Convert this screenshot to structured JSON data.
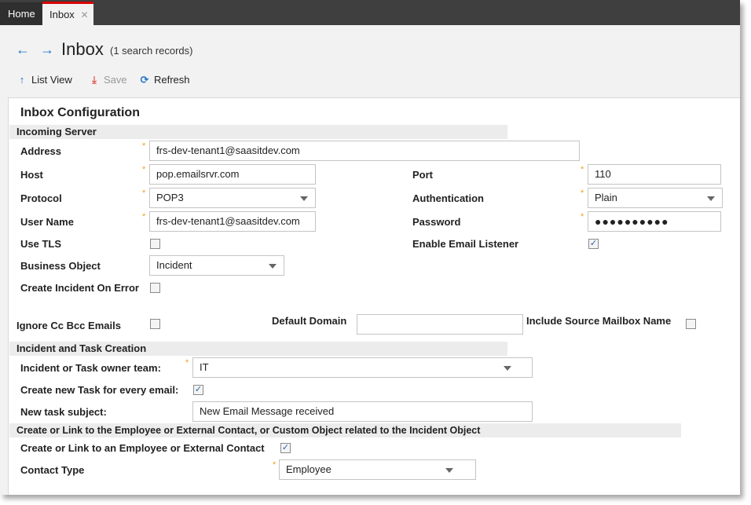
{
  "tabs": [
    {
      "label": "Home"
    },
    {
      "label": "Inbox",
      "close": "✕"
    }
  ],
  "header": {
    "title": "Inbox",
    "record_count": "(1 search records)"
  },
  "toolbar": {
    "list_view": "List View",
    "save": "Save",
    "refresh": "Refresh"
  },
  "form": {
    "title": "Inbox Configuration",
    "sections": {
      "incoming": "Incoming Server",
      "incident_task": "Incident and Task Creation",
      "link": "Create or Link to the Employee or External Contact, or Custom Object related to the Incident Object"
    },
    "required_mark": "*",
    "address": {
      "label": "Address",
      "value": "frs-dev-tenant1@saasitdev.com"
    },
    "host": {
      "label": "Host",
      "value": "pop.emailsrvr.com"
    },
    "port": {
      "label": "Port",
      "value": "110"
    },
    "protocol": {
      "label": "Protocol",
      "value": "POP3"
    },
    "authentication": {
      "label": "Authentication",
      "value": "Plain"
    },
    "user_name": {
      "label": "User Name",
      "value": "frs-dev-tenant1@saasitdev.com"
    },
    "password": {
      "label": "Password",
      "value": "●●●●●●●●●●"
    },
    "use_tls": {
      "label": "Use TLS",
      "checked": false
    },
    "enable_listener": {
      "label": "Enable Email Listener",
      "checked": true
    },
    "business_object": {
      "label": "Business Object",
      "value": "Incident"
    },
    "create_incident_on_error": {
      "label": "Create Incident On Error",
      "checked": false
    },
    "ignore_cc_bcc": {
      "label": "Ignore Cc Bcc Emails",
      "checked": false
    },
    "default_domain": {
      "label": "Default Domain",
      "value": ""
    },
    "include_source_mailbox": {
      "label": "Include Source Mailbox Name",
      "checked": false
    },
    "owner_team": {
      "label": "Incident or Task owner team:",
      "value": "IT"
    },
    "new_task_every_email": {
      "label": "Create new Task for every email:",
      "checked": true
    },
    "new_task_subject": {
      "label": "New task subject:",
      "value": "New Email Message received"
    },
    "create_link_contact": {
      "label": "Create or Link to an Employee or External Contact",
      "checked": true
    },
    "contact_type": {
      "label": "Contact Type",
      "value": "Employee"
    }
  },
  "check_glyph": "✓",
  "colors": {
    "accent": "#1f73c6",
    "tab_active_border": "#d60000",
    "required": "#f0a020",
    "save_icon": "#e05a4e"
  }
}
